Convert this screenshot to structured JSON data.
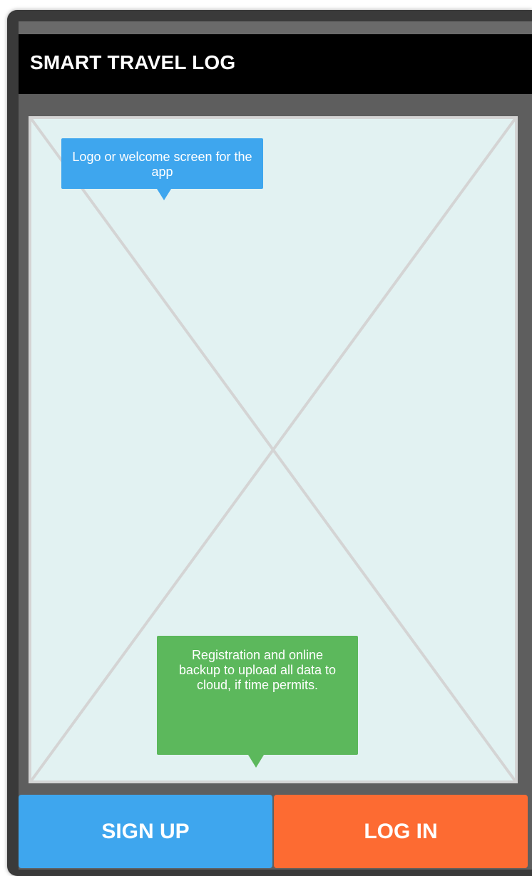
{
  "header": {
    "title": "SMART TRAVEL LOG"
  },
  "placeholder": {
    "icon": "image-placeholder-icon"
  },
  "notes": {
    "logo_note": "Logo or welcome screen for the app",
    "backup_note": "Registration and online backup to upload all data to cloud, if time permits."
  },
  "actions": {
    "signup_label": "SIGN UP",
    "login_label": "LOG IN"
  },
  "colors": {
    "header_bg": "#000000",
    "placeholder_bg": "#e2f2f2",
    "note_blue": "#3ea6ee",
    "note_green": "#5cb85c",
    "signup_bg": "#3ea6ee",
    "login_bg": "#fd6b32"
  }
}
